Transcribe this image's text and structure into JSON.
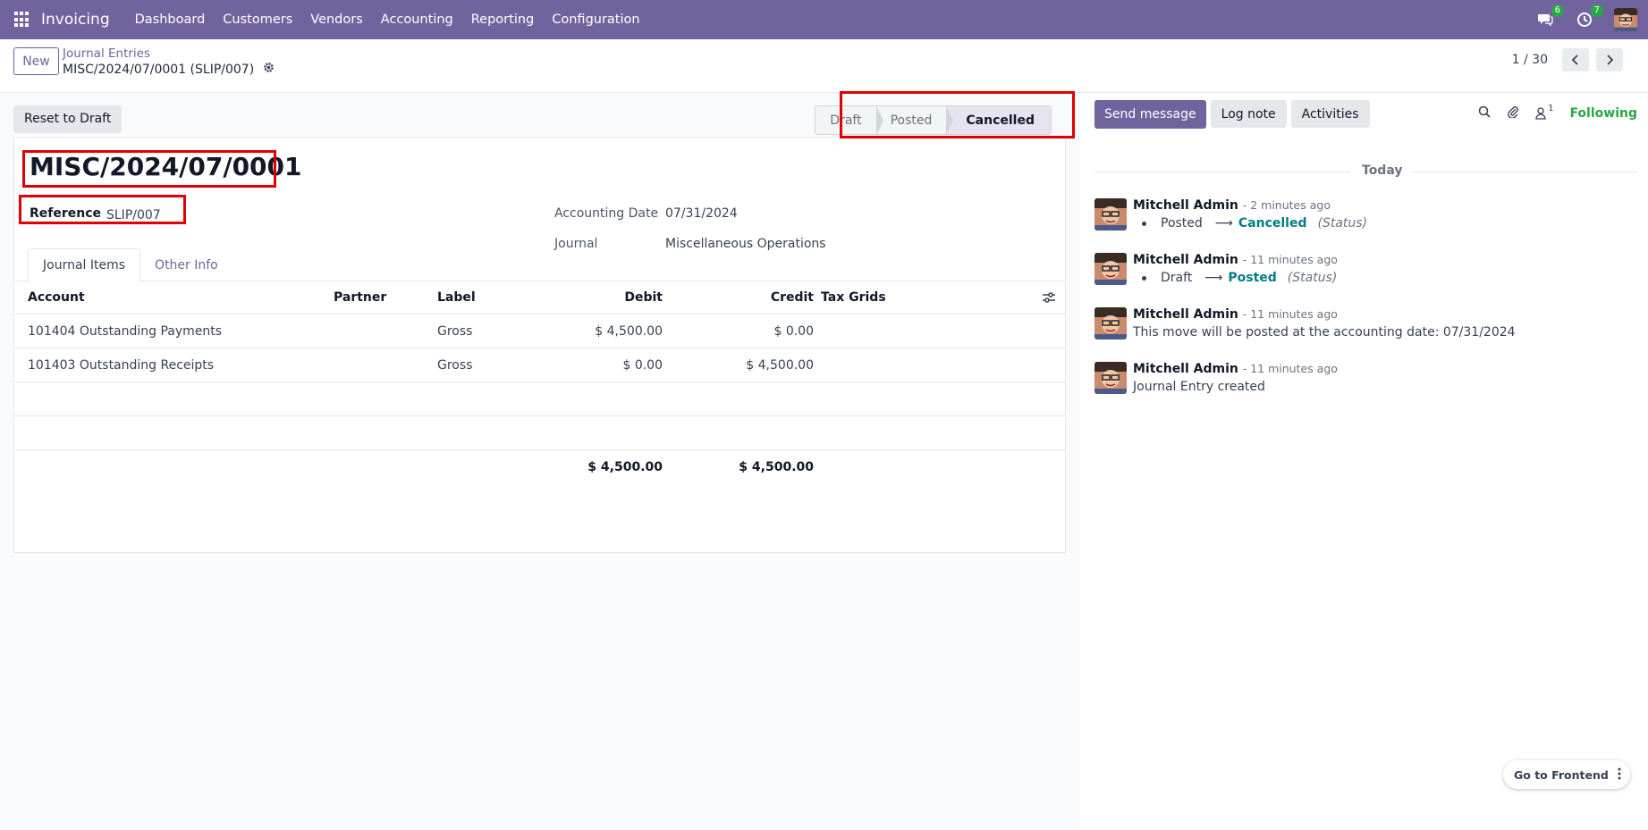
{
  "topbar": {
    "app_name": "Invoicing",
    "menu": [
      "Dashboard",
      "Customers",
      "Vendors",
      "Accounting",
      "Reporting",
      "Configuration"
    ],
    "messages_badge": "6",
    "activities_badge": "7"
  },
  "control_panel": {
    "new_label": "New",
    "breadcrumb_parent": "Journal Entries",
    "breadcrumb_current": "MISC/2024/07/0001 (SLIP/007)",
    "pager": "1 / 30"
  },
  "statusbar": {
    "reset_label": "Reset to Draft",
    "stages": [
      "Draft",
      "Posted",
      "Cancelled"
    ],
    "active_stage": "Cancelled"
  },
  "form": {
    "title": "MISC/2024/07/0001",
    "reference_label": "Reference",
    "reference_value": "SLIP/007",
    "accounting_date_label": "Accounting Date",
    "accounting_date_value": "07/31/2024",
    "journal_label": "Journal",
    "journal_value": "Miscellaneous Operations",
    "tabs": [
      "Journal Items",
      "Other Info"
    ]
  },
  "table": {
    "headers": [
      "Account",
      "Partner",
      "Label",
      "Debit",
      "Credit",
      "Tax Grids"
    ],
    "rows": [
      {
        "account": "101404 Outstanding Payments",
        "partner": "",
        "label": "Gross",
        "debit": "$ 4,500.00",
        "credit": "$ 0.00",
        "tax_grids": ""
      },
      {
        "account": "101403 Outstanding Receipts",
        "partner": "",
        "label": "Gross",
        "debit": "$ 0.00",
        "credit": "$ 4,500.00",
        "tax_grids": ""
      }
    ],
    "total_debit": "$ 4,500.00",
    "total_credit": "$ 4,500.00"
  },
  "chatter": {
    "send_message": "Send message",
    "log_note": "Log note",
    "activities": "Activities",
    "followers_count": "1",
    "following": "Following",
    "today": "Today",
    "messages": [
      {
        "author": "Mitchell Admin",
        "time": "- 2 minutes ago",
        "old": "Posted",
        "arrow": "⟶",
        "new": "Cancelled",
        "field": "(Status)"
      },
      {
        "author": "Mitchell Admin",
        "time": "- 11 minutes ago",
        "old": "Draft",
        "arrow": "⟶",
        "new": "Posted",
        "field": "(Status)"
      },
      {
        "author": "Mitchell Admin",
        "time": "- 11 minutes ago",
        "text": "This move will be posted at the accounting date: 07/31/2024"
      },
      {
        "author": "Mitchell Admin",
        "time": "- 11 minutes ago",
        "text": "Journal Entry created"
      }
    ]
  },
  "footer": {
    "go_frontend": "Go to Frontend"
  },
  "colors": {
    "brand": "#71639e",
    "highlight_outline": "#e00000",
    "status_link": "#017e84",
    "following": "#28a745"
  }
}
